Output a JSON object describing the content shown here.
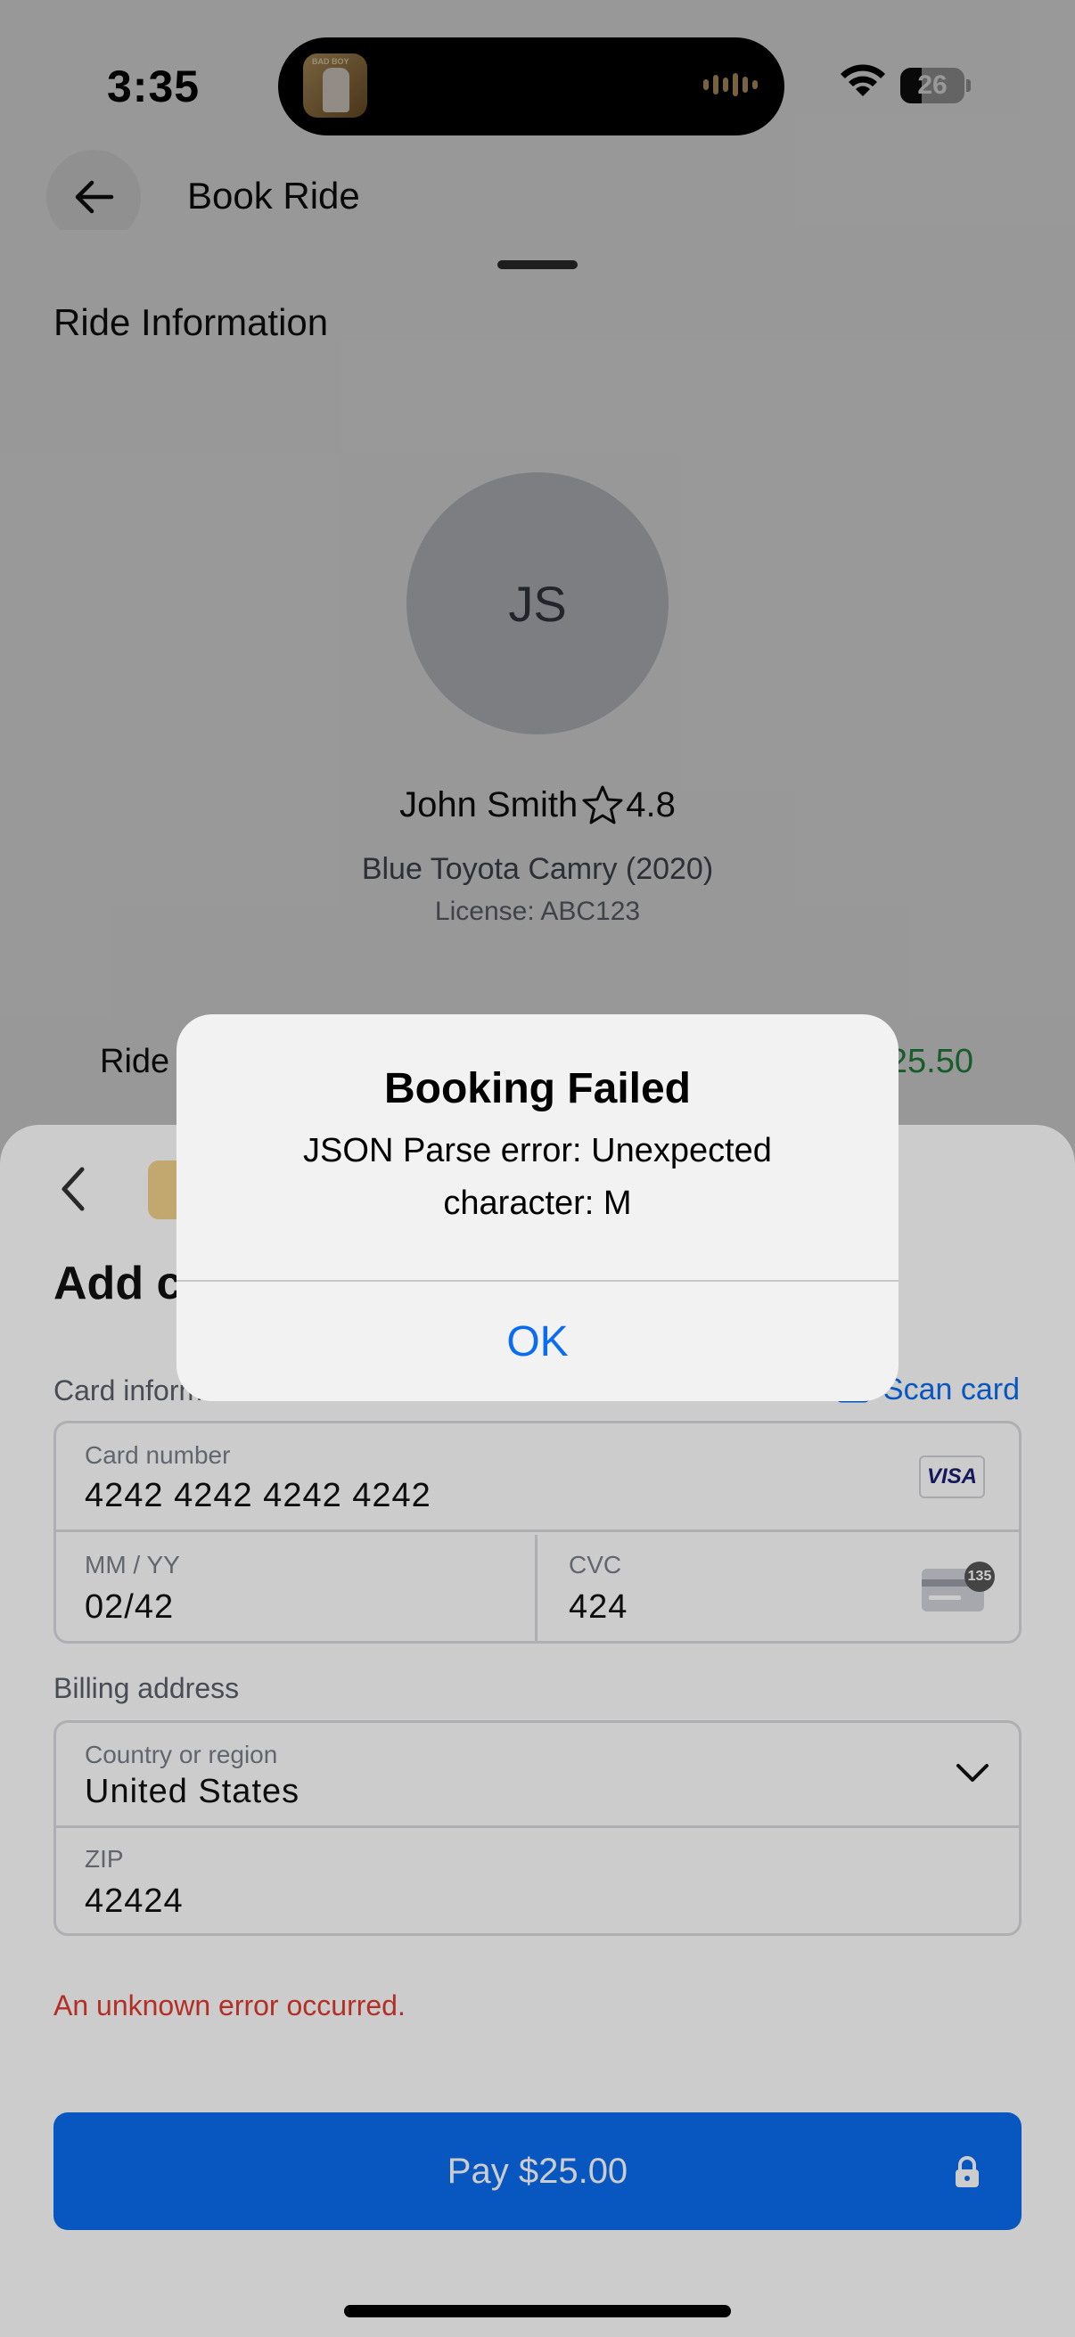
{
  "status_bar": {
    "time": "3:35",
    "battery": "26",
    "island_art_text": "BAD BOY"
  },
  "header": {
    "title": "Book Ride",
    "back_icon": "arrow-left-icon"
  },
  "ride": {
    "section_title": "Ride Information",
    "driver_initials": "JS",
    "driver_name": "John Smith",
    "rating": "4.8",
    "vehicle": "Blue Toyota Camry (2020)",
    "license": "License: ABC123",
    "price_label": "Ride",
    "price_value": "$25.50"
  },
  "payment": {
    "title": "Add c",
    "card_info_label": "Card information",
    "scan_card": "Scan card",
    "card_number_label": "Card number",
    "card_number": "4242 4242 4242 4242",
    "card_brand": "VISA",
    "expiry_label": "MM / YY",
    "expiry": "02/42",
    "cvc_label": "CVC",
    "cvc": "424",
    "cvc_badge": "135",
    "billing_label": "Billing address",
    "country_label": "Country or region",
    "country": "United States",
    "zip_label": "ZIP",
    "zip": "42424",
    "error": "An unknown error occurred.",
    "pay_button": "Pay $25.00"
  },
  "alert": {
    "title": "Booking Failed",
    "message": "JSON Parse error: Unexpected character: M",
    "ok": "OK"
  },
  "colors": {
    "accent": "#0a6cf0",
    "price_green": "#2b9a4a",
    "error_red": "#e03a2f"
  }
}
